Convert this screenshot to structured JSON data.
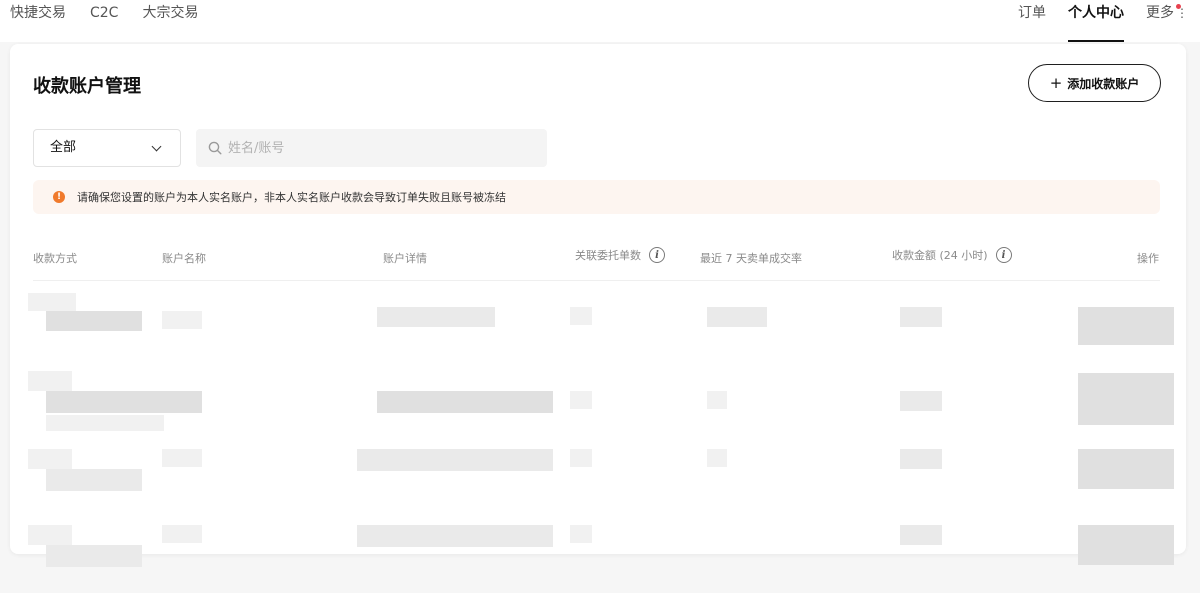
{
  "topnav": {
    "left_items": [
      "快捷交易",
      "C2C",
      "大宗交易"
    ],
    "right_items": [
      "订单",
      "个人中心",
      "更多"
    ],
    "active": "个人中心"
  },
  "page": {
    "title": "收款账户管理",
    "add_button_label": "添加收款账户"
  },
  "filters": {
    "select_value": "全部",
    "search_placeholder": "姓名/账号"
  },
  "notice": {
    "text": "请确保您设置的账户为本人实名账户，非本人实名账户收款会导致订单失败且账号被冻结"
  },
  "table": {
    "columns": [
      "收款方式",
      "账户名称",
      "账户详情",
      "关联委托单数",
      "最近 7 天卖单成交率",
      "收款金额 (24 小时)",
      "操作"
    ],
    "rows_visible": 4,
    "rows_blurred": true
  },
  "colors": {
    "accent": "#111111",
    "warning": "#f07a2c",
    "notice_bg": "#fdf5f0",
    "badge_dot": "#e8424f"
  }
}
